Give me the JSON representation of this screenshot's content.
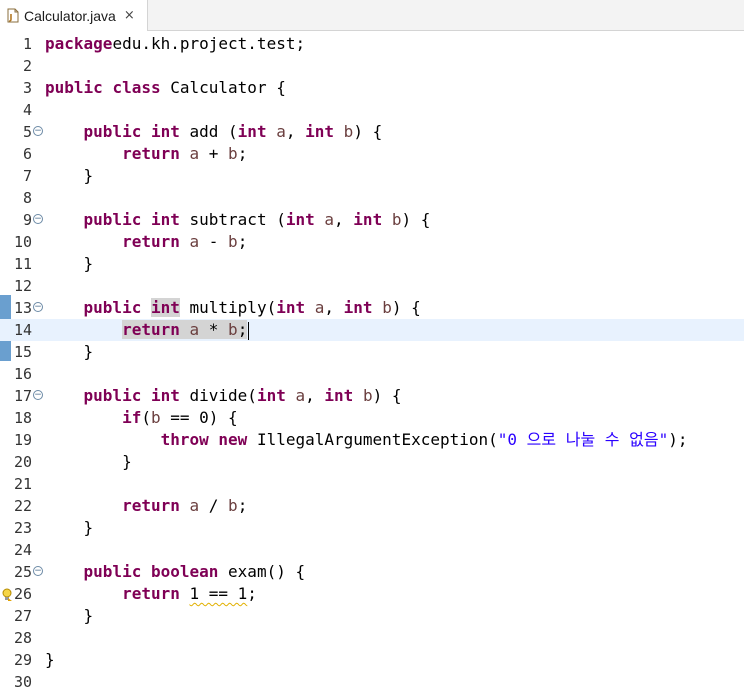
{
  "tab": {
    "title": "Calculator.java",
    "close": "×"
  },
  "lines": [
    {
      "num": "1",
      "tokens": [
        [
          "kw",
          "package"
        ],
        [
          "",
          "edu.kh.project.test;"
        ]
      ]
    },
    {
      "num": "2",
      "tokens": []
    },
    {
      "num": "3",
      "tokens": [
        [
          "kw",
          "public"
        ],
        [
          "",
          " "
        ],
        [
          "kw",
          "class"
        ],
        [
          "",
          " Calculator {"
        ]
      ]
    },
    {
      "num": "4",
      "tokens": []
    },
    {
      "num": "5",
      "fold": true,
      "tokens": [
        [
          "",
          "    "
        ],
        [
          "kw",
          "public"
        ],
        [
          "",
          " "
        ],
        [
          "kw",
          "int"
        ],
        [
          "",
          " add ("
        ],
        [
          "kw",
          "int"
        ],
        [
          "",
          " "
        ],
        [
          "param",
          "a"
        ],
        [
          "",
          ", "
        ],
        [
          "kw",
          "int"
        ],
        [
          "",
          " "
        ],
        [
          "param",
          "b"
        ],
        [
          "",
          ") {"
        ]
      ]
    },
    {
      "num": "6",
      "tokens": [
        [
          "",
          "        "
        ],
        [
          "kw",
          "return"
        ],
        [
          "",
          " "
        ],
        [
          "param",
          "a"
        ],
        [
          "",
          "",
          " + "
        ],
        [
          "param",
          "b"
        ],
        [
          "",
          ";"
        ]
      ]
    },
    {
      "num": "7",
      "tokens": [
        [
          "",
          "    }"
        ]
      ]
    },
    {
      "num": "8",
      "tokens": []
    },
    {
      "num": "9",
      "fold": true,
      "tokens": [
        [
          "",
          "    "
        ],
        [
          "kw",
          "public"
        ],
        [
          "",
          " "
        ],
        [
          "kw",
          "int"
        ],
        [
          "",
          " subtract ("
        ],
        [
          "kw",
          "int"
        ],
        [
          "",
          " "
        ],
        [
          "param",
          "a"
        ],
        [
          "",
          ", "
        ],
        [
          "kw",
          "int"
        ],
        [
          "",
          " "
        ],
        [
          "param",
          "b"
        ],
        [
          "",
          ") {"
        ]
      ]
    },
    {
      "num": "10",
      "tokens": [
        [
          "",
          "        "
        ],
        [
          "kw",
          "return"
        ],
        [
          "",
          " "
        ],
        [
          "param",
          "a"
        ],
        [
          "",
          " - "
        ],
        [
          "param",
          "b"
        ],
        [
          "",
          ";"
        ]
      ]
    },
    {
      "num": "11",
      "tokens": [
        [
          "",
          "    }"
        ]
      ]
    },
    {
      "num": "12",
      "tokens": []
    },
    {
      "num": "13",
      "fold": true,
      "tokens": [
        [
          "",
          "    "
        ],
        [
          "kw",
          "public"
        ],
        [
          "",
          " "
        ],
        [
          "kw occ",
          "int"
        ],
        [
          "",
          " multiply("
        ],
        [
          "kw",
          "int"
        ],
        [
          "",
          " "
        ],
        [
          "param",
          "a"
        ],
        [
          "",
          ", "
        ],
        [
          "kw",
          "int"
        ],
        [
          "",
          " "
        ],
        [
          "param",
          "b"
        ],
        [
          "",
          ") {"
        ]
      ]
    },
    {
      "num": "14",
      "current": true,
      "tokens": [
        [
          "",
          "        "
        ],
        [
          "kw occ",
          "return"
        ],
        [
          "occ",
          " "
        ],
        [
          "param occ",
          "a"
        ],
        [
          "occ",
          " * "
        ],
        [
          "param occ",
          "b"
        ],
        [
          "occ",
          ";"
        ],
        [
          "caret",
          ""
        ]
      ]
    },
    {
      "num": "15",
      "tokens": [
        [
          "",
          "    }"
        ]
      ]
    },
    {
      "num": "16",
      "tokens": []
    },
    {
      "num": "17",
      "fold": true,
      "tokens": [
        [
          "",
          "    "
        ],
        [
          "kw",
          "public"
        ],
        [
          "",
          " "
        ],
        [
          "kw",
          "int"
        ],
        [
          "",
          " divide("
        ],
        [
          "kw",
          "int"
        ],
        [
          "",
          " "
        ],
        [
          "param",
          "a"
        ],
        [
          "",
          ", "
        ],
        [
          "kw",
          "int"
        ],
        [
          "",
          " "
        ],
        [
          "param",
          "b"
        ],
        [
          "",
          ") {"
        ]
      ]
    },
    {
      "num": "18",
      "tokens": [
        [
          "",
          "        "
        ],
        [
          "kw",
          "if"
        ],
        [
          "",
          "("
        ],
        [
          "param",
          "b"
        ],
        [
          "",
          " == 0) {"
        ]
      ]
    },
    {
      "num": "19",
      "tokens": [
        [
          "",
          "            "
        ],
        [
          "kw",
          "throw"
        ],
        [
          "",
          " "
        ],
        [
          "kw",
          "new"
        ],
        [
          "",
          " IllegalArgumentException("
        ],
        [
          "str",
          "\"0 으로 나눌 수 없음\""
        ],
        [
          "",
          ");"
        ]
      ]
    },
    {
      "num": "20",
      "tokens": [
        [
          "",
          "        }"
        ]
      ]
    },
    {
      "num": "21",
      "tokens": []
    },
    {
      "num": "22",
      "tokens": [
        [
          "",
          "        "
        ],
        [
          "kw",
          "return"
        ],
        [
          "",
          " "
        ],
        [
          "param",
          "a"
        ],
        [
          "",
          " / "
        ],
        [
          "param",
          "b"
        ],
        [
          "",
          ";"
        ]
      ]
    },
    {
      "num": "23",
      "tokens": [
        [
          "",
          "    }"
        ]
      ]
    },
    {
      "num": "24",
      "tokens": []
    },
    {
      "num": "25",
      "fold": true,
      "tokens": [
        [
          "",
          "    "
        ],
        [
          "kw",
          "public"
        ],
        [
          "",
          " "
        ],
        [
          "kw",
          "boolean"
        ],
        [
          "",
          " exam() {"
        ]
      ]
    },
    {
      "num": "26",
      "warning": true,
      "tokens": [
        [
          "",
          "        "
        ],
        [
          "kw",
          "return"
        ],
        [
          "",
          " "
        ],
        [
          "warn-u",
          "1 == 1"
        ],
        [
          "",
          ";"
        ]
      ]
    },
    {
      "num": "27",
      "tokens": [
        [
          "",
          "    }"
        ]
      ]
    },
    {
      "num": "28",
      "tokens": []
    },
    {
      "num": "29",
      "tokens": [
        [
          "",
          "}"
        ]
      ]
    },
    {
      "num": "30",
      "tokens": []
    }
  ],
  "colors": {
    "keyword": "#7f0055",
    "parameter": "#6a3e3e",
    "string": "#2a00ff",
    "current_line": "#e8f2fe",
    "occurrence": "#d4d4d4",
    "change_bar": "#6a9fcf"
  },
  "icons": {
    "tab": "java-file-icon",
    "fold": "collapse-icon",
    "warning": "warning-lightbulb-icon"
  }
}
